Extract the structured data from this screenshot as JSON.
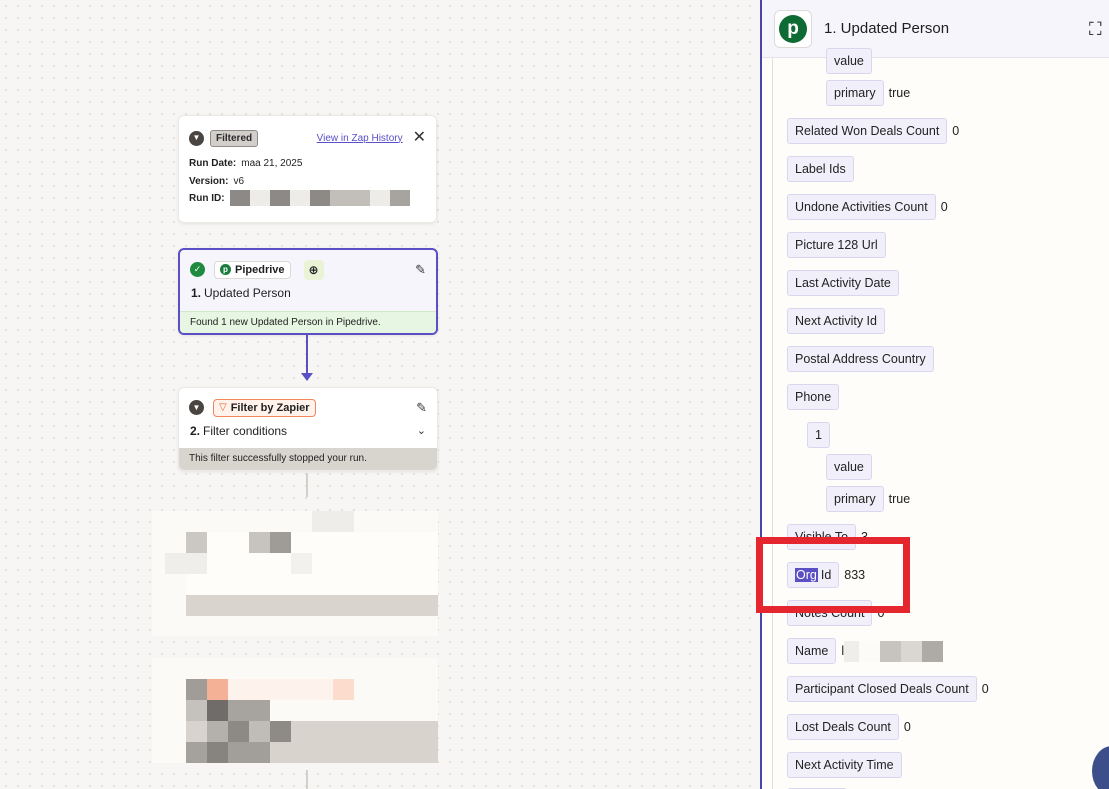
{
  "history": {
    "badge": "Filtered",
    "zap_link": "View in Zap History",
    "close": "✕",
    "run_date_label": "Run Date:",
    "run_date_value": "maa 21, 2025",
    "version_label": "Version:",
    "version_value": "v6",
    "run_id_label": "Run ID:"
  },
  "step1": {
    "check": "✓",
    "app": "Pipedrive",
    "add": "⊕",
    "edit": "✎",
    "number": "1.",
    "title": "Updated Person",
    "footer": "Found 1 new Updated Person in Pipedrive."
  },
  "step2": {
    "app": "Filter by Zapier",
    "edit": "✎",
    "number": "2.",
    "title": "Filter conditions",
    "footer": "This filter successfully stopped your run."
  },
  "panel": {
    "logo": "p",
    "title": "1. Updated Person",
    "expand": "⛶",
    "fields": [
      {
        "label": "value",
        "value": ""
      },
      {
        "label": "primary",
        "value": "true"
      },
      {
        "label": "Related Won Deals Count",
        "value": "0"
      },
      {
        "label": "Label Ids",
        "value": ""
      },
      {
        "label": "Undone Activities Count",
        "value": "0"
      },
      {
        "label": "Picture 128 Url",
        "value": ""
      },
      {
        "label": "Last Activity Date",
        "value": ""
      },
      {
        "label": "Next Activity Id",
        "value": ""
      },
      {
        "label": "Postal Address Country",
        "value": ""
      },
      {
        "label": "Phone",
        "value": ""
      },
      {
        "label": "1",
        "value": ""
      },
      {
        "label": "value",
        "value": ""
      },
      {
        "label": "primary",
        "value": "true"
      },
      {
        "label": "Visible To",
        "value": "3"
      },
      {
        "label_highlight": "Org",
        "label_rest": "Id",
        "value": "833"
      },
      {
        "label": "Notes Count",
        "value": "0"
      },
      {
        "label": "Name",
        "value": "l"
      },
      {
        "label": "Participant Closed Deals Count",
        "value": "0"
      },
      {
        "label": "Lost Deals Count",
        "value": "0"
      },
      {
        "label": "Next Activity Time",
        "value": ""
      }
    ]
  }
}
